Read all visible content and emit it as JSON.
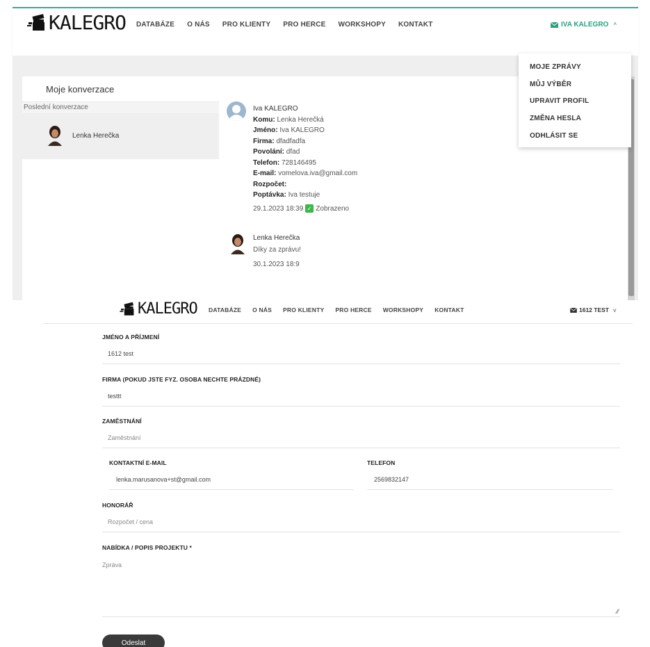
{
  "brand": {
    "logo_text": "KALEGRO",
    "accent": "#2aa07f",
    "teal_line": "#3aa89a"
  },
  "nav_links": [
    "DATABÁZE",
    "O NÁS",
    "PRO KLIENTY",
    "PRO HERCE",
    "WORKSHOPY",
    "KONTAKT"
  ],
  "messages_page": {
    "user_menu_label": "IVA KALEGRO",
    "dropdown": [
      "MOJE ZPRÁVY",
      "MŮJ VÝBĚR",
      "UPRAVIT PROFIL",
      "ZMĚNA HESLA",
      "ODHLÁSIT SE"
    ],
    "conversations": {
      "title": "Moje konverzace",
      "subtitle": "Poslední konverzace",
      "items": [
        {
          "name": "Lenka Herečka"
        }
      ]
    },
    "thread": {
      "message1": {
        "sender": "Iva KALEGRO",
        "fields": [
          {
            "label": "Komu:",
            "value": "Lenka Herečká"
          },
          {
            "label": "Jméno:",
            "value": "Iva KALEGRO"
          },
          {
            "label": "Firma:",
            "value": "dfadfadfa"
          },
          {
            "label": "Povolání:",
            "value": "dfad"
          },
          {
            "label": "Telefon:",
            "value": "728146495"
          },
          {
            "label": "E-mail:",
            "value": "vomelova.iva@gmail.com"
          },
          {
            "label": "Rozpočet:",
            "value": ""
          },
          {
            "label": "Poptávka:",
            "value": "Iva testuje"
          }
        ],
        "timestamp": "29.1.2023 18:39",
        "status": "Zobrazeno"
      },
      "message2": {
        "sender": "Lenka Herečka",
        "text": "Díky za zprávu!",
        "timestamp": "30.1.2023 18:9"
      }
    }
  },
  "form_page": {
    "user_menu_label": "1612 TEST",
    "fields": {
      "name": {
        "label": "JMÉNO A PŘÍJMENÍ",
        "value": "1612 test"
      },
      "company": {
        "label": "FIRMA (POKUD JSTE FYZ. OSOBA NECHTE PRÁZDNÉ)",
        "value": "testtt"
      },
      "job": {
        "label": "ZAMĚSTNÁNÍ",
        "placeholder": "Zaměstnání"
      },
      "email": {
        "label": "KONTAKTNÍ E-MAIL",
        "value": "lenka.marusanova+st@gmail.com"
      },
      "phone": {
        "label": "TELEFON",
        "value": "2569832147"
      },
      "fee": {
        "label": "HONORÁŘ",
        "placeholder": "Rozpočet / cena"
      },
      "offer": {
        "label": "NABÍDKA / POPIS PROJEKTU *",
        "placeholder": "Zpráva"
      }
    },
    "submit_label": "Odeslat"
  }
}
